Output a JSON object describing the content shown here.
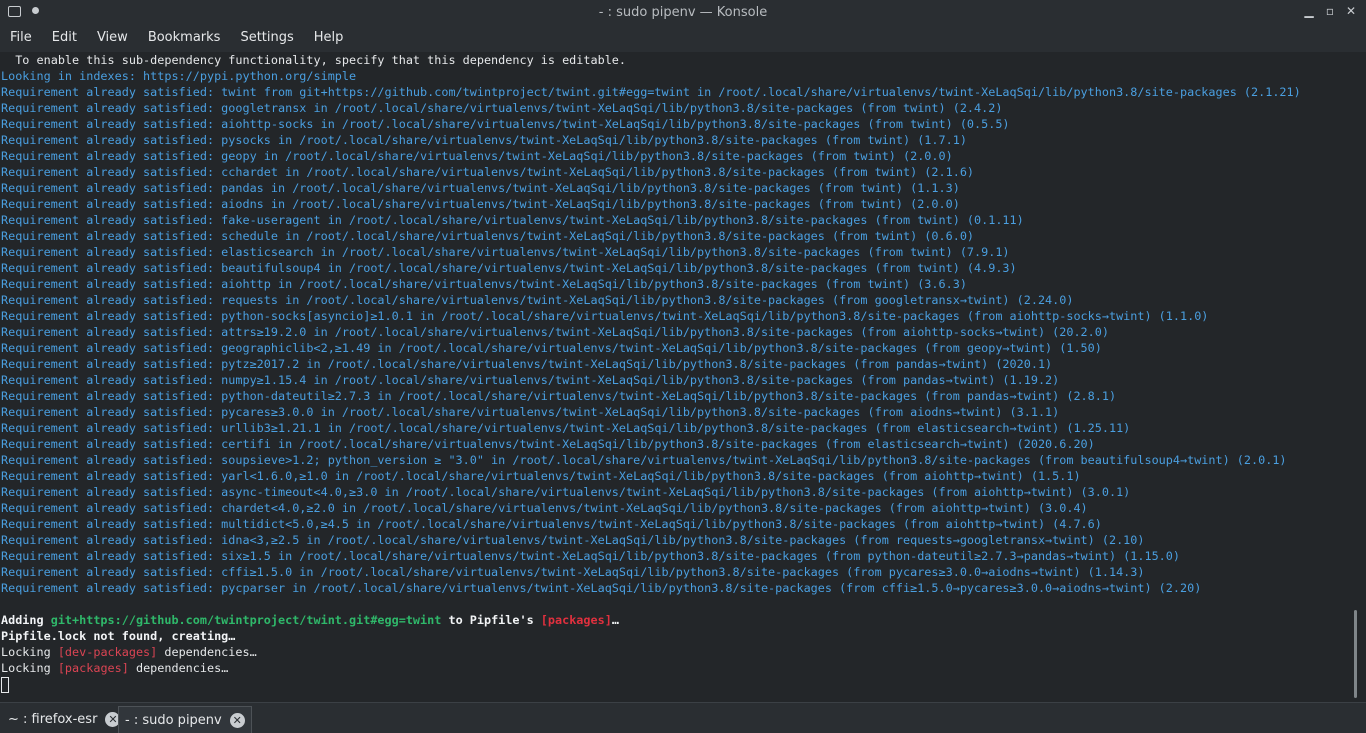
{
  "window": {
    "title": "- : sudo pipenv — Konsole",
    "minimize_glyph": "▁",
    "maximize_glyph": "▫",
    "close_glyph": "✕"
  },
  "menu": [
    "File",
    "Edit",
    "View",
    "Bookmarks",
    "Settings",
    "Help"
  ],
  "terminal": {
    "lines": [
      [
        {
          "t": "  To enable this sub-dependency functionality, specify that this dependency is editable.",
          "c": "c-white"
        }
      ],
      [
        {
          "t": "Looking in indexes: https://pypi.python.org/simple"
        }
      ],
      [
        {
          "t": "Requirement already satisfied: twint from git+https://github.com/twintproject/twint.git#egg=twint in /root/.local/share/virtualenvs/twint-XeLaqSqi/lib/python3.8/site-packages (2.1.21)"
        }
      ],
      [
        {
          "t": "Requirement already satisfied: googletransx in /root/.local/share/virtualenvs/twint-XeLaqSqi/lib/python3.8/site-packages (from twint) (2.4.2)"
        }
      ],
      [
        {
          "t": "Requirement already satisfied: aiohttp-socks in /root/.local/share/virtualenvs/twint-XeLaqSqi/lib/python3.8/site-packages (from twint) (0.5.5)"
        }
      ],
      [
        {
          "t": "Requirement already satisfied: pysocks in /root/.local/share/virtualenvs/twint-XeLaqSqi/lib/python3.8/site-packages (from twint) (1.7.1)"
        }
      ],
      [
        {
          "t": "Requirement already satisfied: geopy in /root/.local/share/virtualenvs/twint-XeLaqSqi/lib/python3.8/site-packages (from twint) (2.0.0)"
        }
      ],
      [
        {
          "t": "Requirement already satisfied: cchardet in /root/.local/share/virtualenvs/twint-XeLaqSqi/lib/python3.8/site-packages (from twint) (2.1.6)"
        }
      ],
      [
        {
          "t": "Requirement already satisfied: pandas in /root/.local/share/virtualenvs/twint-XeLaqSqi/lib/python3.8/site-packages (from twint) (1.1.3)"
        }
      ],
      [
        {
          "t": "Requirement already satisfied: aiodns in /root/.local/share/virtualenvs/twint-XeLaqSqi/lib/python3.8/site-packages (from twint) (2.0.0)"
        }
      ],
      [
        {
          "t": "Requirement already satisfied: fake-useragent in /root/.local/share/virtualenvs/twint-XeLaqSqi/lib/python3.8/site-packages (from twint) (0.1.11)"
        }
      ],
      [
        {
          "t": "Requirement already satisfied: schedule in /root/.local/share/virtualenvs/twint-XeLaqSqi/lib/python3.8/site-packages (from twint) (0.6.0)"
        }
      ],
      [
        {
          "t": "Requirement already satisfied: elasticsearch in /root/.local/share/virtualenvs/twint-XeLaqSqi/lib/python3.8/site-packages (from twint) (7.9.1)"
        }
      ],
      [
        {
          "t": "Requirement already satisfied: beautifulsoup4 in /root/.local/share/virtualenvs/twint-XeLaqSqi/lib/python3.8/site-packages (from twint) (4.9.3)"
        }
      ],
      [
        {
          "t": "Requirement already satisfied: aiohttp in /root/.local/share/virtualenvs/twint-XeLaqSqi/lib/python3.8/site-packages (from twint) (3.6.3)"
        }
      ],
      [
        {
          "t": "Requirement already satisfied: requests in /root/.local/share/virtualenvs/twint-XeLaqSqi/lib/python3.8/site-packages (from googletransx→twint) (2.24.0)"
        }
      ],
      [
        {
          "t": "Requirement already satisfied: python-socks[asyncio]≥1.0.1 in /root/.local/share/virtualenvs/twint-XeLaqSqi/lib/python3.8/site-packages (from aiohttp-socks→twint) (1.1.0)"
        }
      ],
      [
        {
          "t": "Requirement already satisfied: attrs≥19.2.0 in /root/.local/share/virtualenvs/twint-XeLaqSqi/lib/python3.8/site-packages (from aiohttp-socks→twint) (20.2.0)"
        }
      ],
      [
        {
          "t": "Requirement already satisfied: geographiclib<2,≥1.49 in /root/.local/share/virtualenvs/twint-XeLaqSqi/lib/python3.8/site-packages (from geopy→twint) (1.50)"
        }
      ],
      [
        {
          "t": "Requirement already satisfied: pytz≥2017.2 in /root/.local/share/virtualenvs/twint-XeLaqSqi/lib/python3.8/site-packages (from pandas→twint) (2020.1)"
        }
      ],
      [
        {
          "t": "Requirement already satisfied: numpy≥1.15.4 in /root/.local/share/virtualenvs/twint-XeLaqSqi/lib/python3.8/site-packages (from pandas→twint) (1.19.2)"
        }
      ],
      [
        {
          "t": "Requirement already satisfied: python-dateutil≥2.7.3 in /root/.local/share/virtualenvs/twint-XeLaqSqi/lib/python3.8/site-packages (from pandas→twint) (2.8.1)"
        }
      ],
      [
        {
          "t": "Requirement already satisfied: pycares≥3.0.0 in /root/.local/share/virtualenvs/twint-XeLaqSqi/lib/python3.8/site-packages (from aiodns→twint) (3.1.1)"
        }
      ],
      [
        {
          "t": "Requirement already satisfied: urllib3≥1.21.1 in /root/.local/share/virtualenvs/twint-XeLaqSqi/lib/python3.8/site-packages (from elasticsearch→twint) (1.25.11)"
        }
      ],
      [
        {
          "t": "Requirement already satisfied: certifi in /root/.local/share/virtualenvs/twint-XeLaqSqi/lib/python3.8/site-packages (from elasticsearch→twint) (2020.6.20)"
        }
      ],
      [
        {
          "t": "Requirement already satisfied: soupsieve>1.2; python_version ≥ \"3.0\" in /root/.local/share/virtualenvs/twint-XeLaqSqi/lib/python3.8/site-packages (from beautifulsoup4→twint) (2.0.1)"
        }
      ],
      [
        {
          "t": "Requirement already satisfied: yarl<1.6.0,≥1.0 in /root/.local/share/virtualenvs/twint-XeLaqSqi/lib/python3.8/site-packages (from aiohttp→twint) (1.5.1)"
        }
      ],
      [
        {
          "t": "Requirement already satisfied: async-timeout<4.0,≥3.0 in /root/.local/share/virtualenvs/twint-XeLaqSqi/lib/python3.8/site-packages (from aiohttp→twint) (3.0.1)"
        }
      ],
      [
        {
          "t": "Requirement already satisfied: chardet<4.0,≥2.0 in /root/.local/share/virtualenvs/twint-XeLaqSqi/lib/python3.8/site-packages (from aiohttp→twint) (3.0.4)"
        }
      ],
      [
        {
          "t": "Requirement already satisfied: multidict<5.0,≥4.5 in /root/.local/share/virtualenvs/twint-XeLaqSqi/lib/python3.8/site-packages (from aiohttp→twint) (4.7.6)"
        }
      ],
      [
        {
          "t": "Requirement already satisfied: idna<3,≥2.5 in /root/.local/share/virtualenvs/twint-XeLaqSqi/lib/python3.8/site-packages (from requests→googletransx→twint) (2.10)"
        }
      ],
      [
        {
          "t": "Requirement already satisfied: six≥1.5 in /root/.local/share/virtualenvs/twint-XeLaqSqi/lib/python3.8/site-packages (from python-dateutil≥2.7.3→pandas→twint) (1.15.0)"
        }
      ],
      [
        {
          "t": "Requirement already satisfied: cffi≥1.5.0 in /root/.local/share/virtualenvs/twint-XeLaqSqi/lib/python3.8/site-packages (from pycares≥3.0.0→aiodns→twint) (1.14.3)"
        }
      ],
      [
        {
          "t": "Requirement already satisfied: pycparser in /root/.local/share/virtualenvs/twint-XeLaqSqi/lib/python3.8/site-packages (from cffi≥1.5.0→pycares≥3.0.0→aiodns→twint) (2.20)"
        }
      ],
      [],
      [
        {
          "t": "Adding ",
          "c": "c-bold"
        },
        {
          "t": "git+https://github.com/twintproject/twint.git#egg=twint",
          "c": "c-green"
        },
        {
          "t": " to Pipfile's ",
          "c": "c-bold"
        },
        {
          "t": "[packages]",
          "c": "c-redb"
        },
        {
          "t": "…",
          "c": "c-bold"
        }
      ],
      [
        {
          "t": "Pipfile.lock not found, creating…",
          "c": "c-bold"
        }
      ],
      [
        {
          "t": "Locking ",
          "c": "c-white"
        },
        {
          "t": "[dev-packages]",
          "c": "c-red"
        },
        {
          "t": " dependencies…",
          "c": "c-white"
        }
      ],
      [
        {
          "t": "Locking ",
          "c": "c-white"
        },
        {
          "t": "[packages]",
          "c": "c-red"
        },
        {
          "t": " dependencies…",
          "c": "c-white"
        }
      ]
    ]
  },
  "tabs": [
    {
      "label": "~ : firefox-esr",
      "active": false
    },
    {
      "label": "- : sudo pipenv",
      "active": true
    }
  ],
  "colors": {
    "output_blue": "#4a9fe0",
    "green": "#2fb86a",
    "red": "#da4453",
    "background": "#232629"
  }
}
